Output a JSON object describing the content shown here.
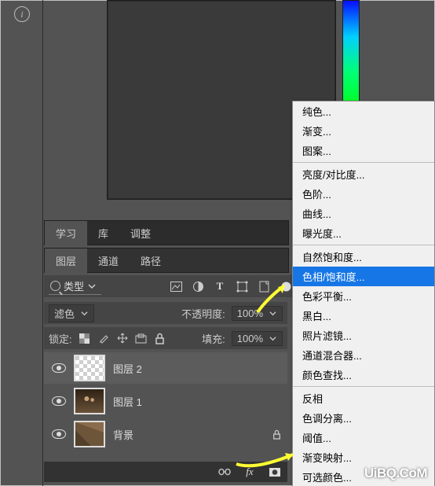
{
  "left": {
    "info": "i"
  },
  "panels": {
    "row1": {
      "learn": "学习",
      "library": "库",
      "adjust": "调整"
    },
    "row2": {
      "layers": "图层",
      "channels": "通道",
      "paths": "路径"
    }
  },
  "filter": {
    "label": "类型"
  },
  "blend": {
    "mode": "滤色",
    "opacity_label": "不透明度:",
    "opacity_value": "100%"
  },
  "lock_row": {
    "label": "锁定:",
    "fill_label": "填充:",
    "fill_value": "100%"
  },
  "layers": [
    {
      "name": "图层 2"
    },
    {
      "name": "图层 1"
    },
    {
      "name": "背景"
    }
  ],
  "fx_label": "fx",
  "menu": {
    "solid": "纯色...",
    "gradient": "渐变...",
    "pattern": "图案...",
    "brightness": "亮度/对比度...",
    "levels": "色阶...",
    "curves": "曲线...",
    "exposure": "曝光度...",
    "vibrance": "自然饱和度...",
    "hue_sat": "色相/饱和度...",
    "color_balance": "色彩平衡...",
    "bw": "黑白...",
    "photo_filter": "照片滤镜...",
    "channel_mixer": "通道混合器...",
    "color_lookup": "颜色查找...",
    "invert": "反相",
    "posterize": "色调分离...",
    "threshold": "阈值...",
    "gradient_map": "渐变映射...",
    "selective_color": "可选颜色..."
  },
  "watermark": "UiBQ.CoM"
}
